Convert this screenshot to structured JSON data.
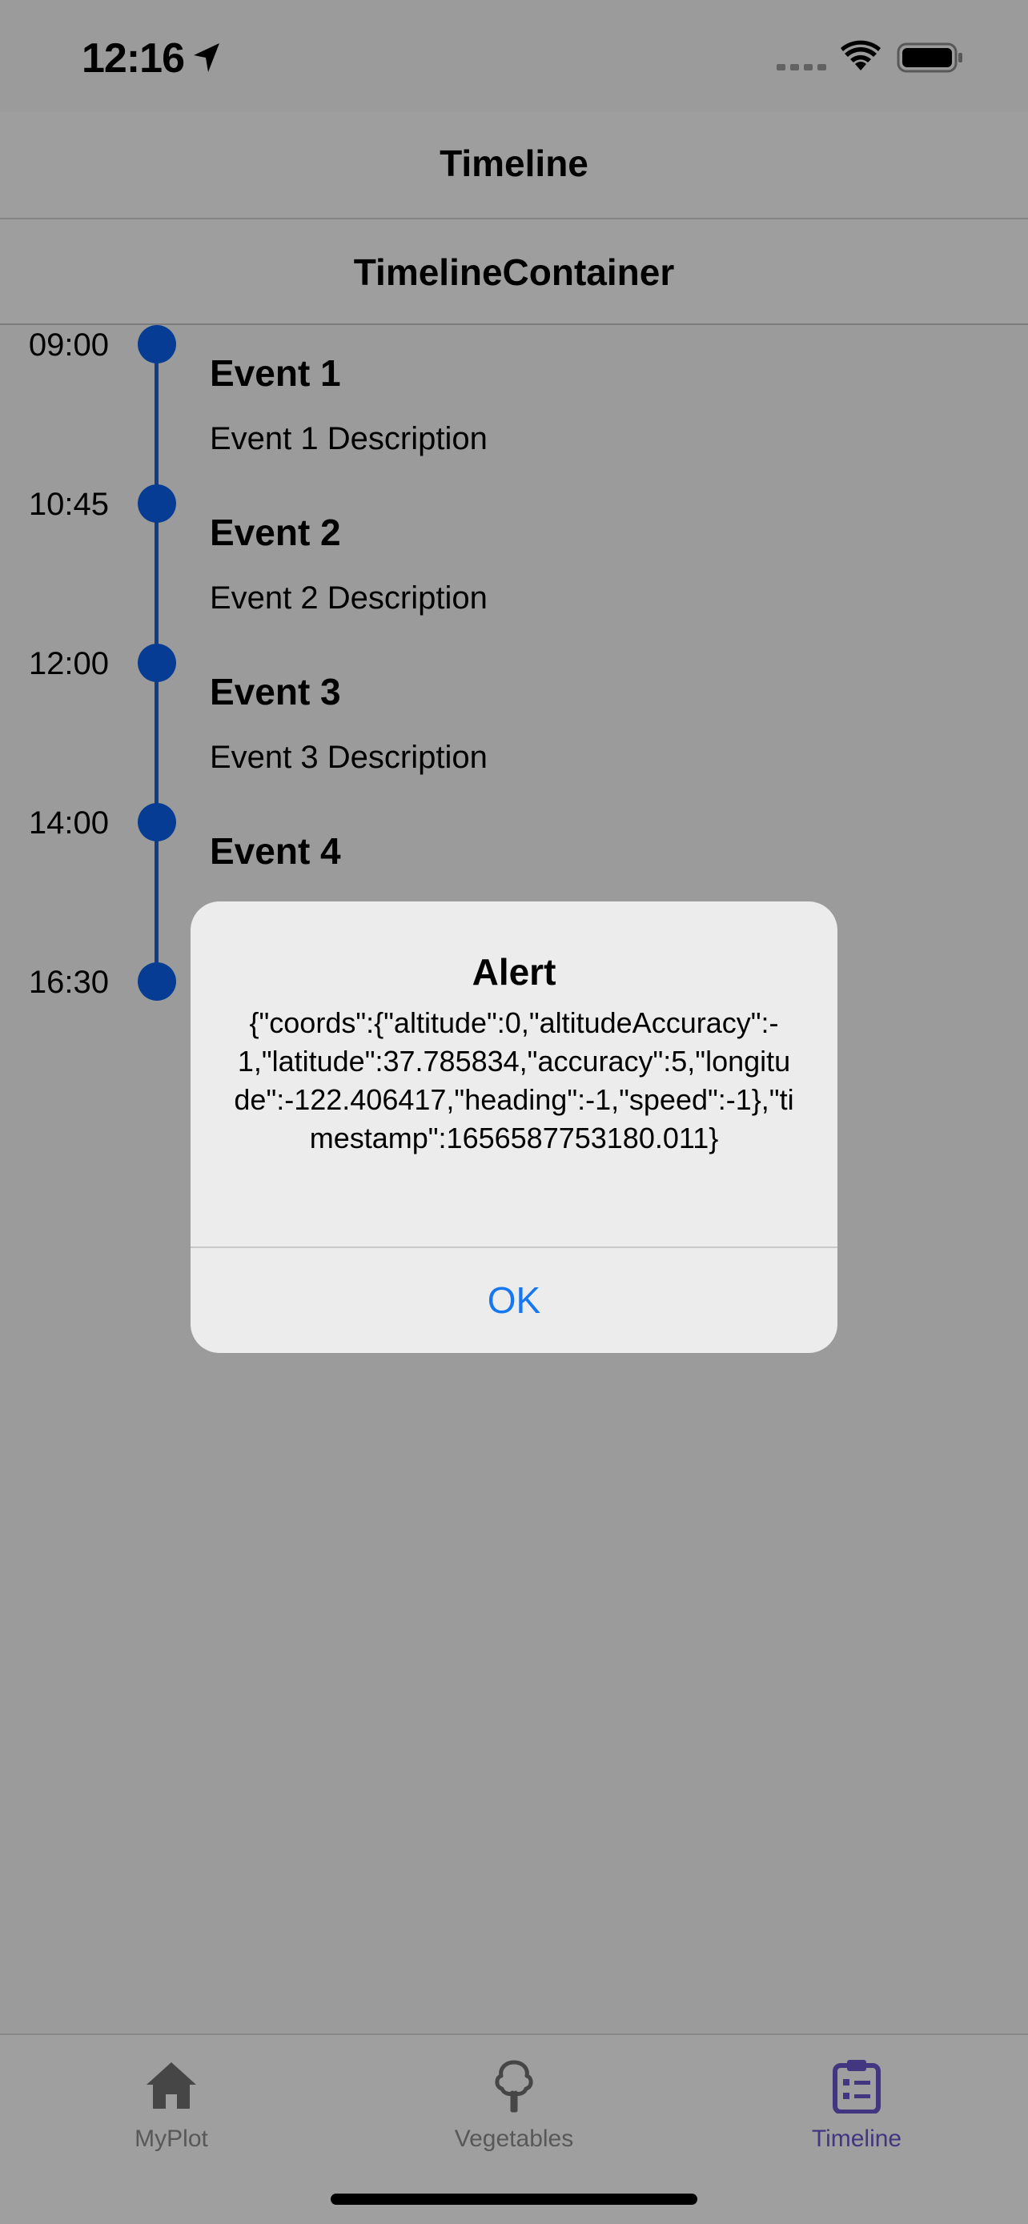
{
  "status_bar": {
    "time": "12:16",
    "location_icon": "location-arrow-icon",
    "signal_icon": "cellular-signal-icon",
    "wifi_icon": "wifi-icon",
    "battery_icon": "battery-icon"
  },
  "nav": {
    "title": "Timeline"
  },
  "container": {
    "title": "TimelineContainer"
  },
  "timeline": {
    "accent_color": "#0a5ee6",
    "events": [
      {
        "time": "09:00",
        "title": "Event 1",
        "description": "Event 1 Description"
      },
      {
        "time": "10:45",
        "title": "Event 2",
        "description": "Event 2 Description"
      },
      {
        "time": "12:00",
        "title": "Event 3",
        "description": "Event 3 Description"
      },
      {
        "time": "14:00",
        "title": "Event 4",
        "description": ""
      },
      {
        "time": "16:30",
        "title": "",
        "description": ""
      }
    ]
  },
  "alert": {
    "title": "Alert",
    "message": "{\"coords\":{\"altitude\":0,\"altitudeAccuracy\":-1,\"latitude\":37.785834,\"accuracy\":5,\"longitude\":-122.406417,\"heading\":-1,\"speed\":-1},\"timestamp\":1656587753180.011}",
    "ok_label": "OK",
    "ok_color": "#1677f0"
  },
  "tab_bar": {
    "active_color": "#6a55c9",
    "tabs": [
      {
        "label": "MyPlot",
        "icon": "home-icon",
        "active": false
      },
      {
        "label": "Vegetables",
        "icon": "tree-icon",
        "active": false
      },
      {
        "label": "Timeline",
        "icon": "clipboard-list-icon",
        "active": true
      }
    ]
  }
}
